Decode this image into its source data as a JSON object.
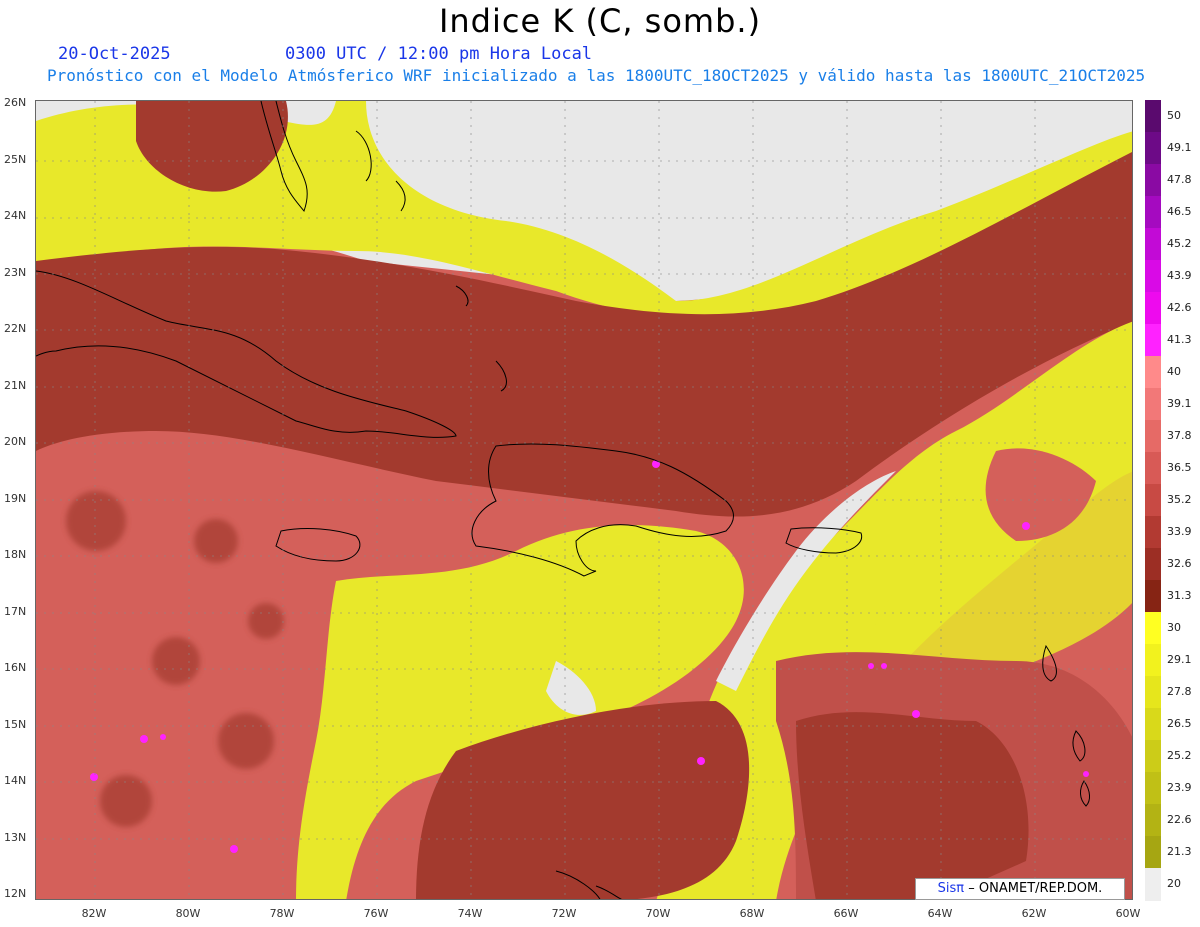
{
  "title": "Indice K (C, somb.)",
  "date": "20-Oct-2025",
  "time_line": "0300 UTC / 12:00 pm Hora Local",
  "model_line": "Pronóstico con el Modelo Atmósferico WRF inicializado a las 1800UTC_18OCT2025 y válido hasta las  1800UTC_21OCT2025",
  "lat_labels": [
    "26N",
    "25N",
    "24N",
    "23N",
    "22N",
    "21N",
    "20N",
    "19N",
    "18N",
    "17N",
    "16N",
    "15N",
    "14N",
    "13N",
    "12N"
  ],
  "lon_labels": [
    "82W",
    "80W",
    "78W",
    "76W",
    "74W",
    "72W",
    "70W",
    "68W",
    "66W",
    "64W",
    "62W",
    "60W"
  ],
  "colorbar": {
    "ticks": [
      "50",
      "49.1",
      "47.8",
      "46.5",
      "45.2",
      "43.9",
      "42.6",
      "41.3",
      "40",
      "39.1",
      "37.8",
      "36.5",
      "35.2",
      "33.9",
      "32.6",
      "31.3",
      "30",
      "29.1",
      "27.8",
      "26.5",
      "25.2",
      "23.9",
      "22.6",
      "21.3",
      "20"
    ],
    "colors": [
      "#5a0a6e",
      "#6d0a87",
      "#8a0aa3",
      "#a50ac0",
      "#c20ad6",
      "#d90ae6",
      "#ee0aee",
      "#ff22ff",
      "#ff8a8a",
      "#f27878",
      "#e66a66",
      "#d85a56",
      "#c84a44",
      "#b23a32",
      "#9c2e24",
      "#862414",
      "#ffff22",
      "#f2f21e",
      "#e6e61c",
      "#d9d91a",
      "#cccc18",
      "#c0c016",
      "#b3b314",
      "#a6a612",
      "#eeeeee"
    ]
  },
  "credit": {
    "brand": "Sisπ",
    "org": "– ONAMET/REP.DOM."
  },
  "colors": {
    "land_outline": "#000000",
    "no_data": "#e8e8e8",
    "high": "#a33a2e",
    "mid": "#d4605a",
    "low": "#e8e82a"
  }
}
